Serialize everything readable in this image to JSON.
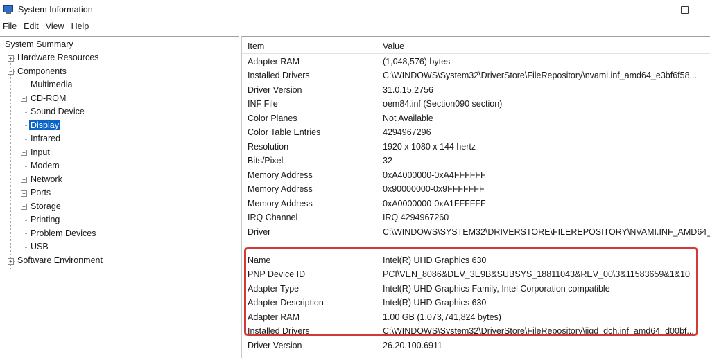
{
  "window": {
    "title": "System Information"
  },
  "menu": [
    "File",
    "Edit",
    "View",
    "Help"
  ],
  "tree": {
    "root": "System Summary",
    "hardware": "Hardware Resources",
    "components": "Components",
    "children": [
      "Multimedia",
      "CD-ROM",
      "Sound Device",
      "Display",
      "Infrared",
      "Input",
      "Modem",
      "Network",
      "Ports",
      "Storage",
      "Printing",
      "Problem Devices",
      "USB"
    ],
    "software": "Software Environment",
    "selected": "Display"
  },
  "table": {
    "headers": {
      "item": "Item",
      "value": "Value"
    },
    "group1": [
      {
        "item": "Adapter RAM",
        "value": "(1,048,576) bytes"
      },
      {
        "item": "Installed Drivers",
        "value": "C:\\WINDOWS\\System32\\DriverStore\\FileRepository\\nvami.inf_amd64_e3bf6f58..."
      },
      {
        "item": "Driver Version",
        "value": "31.0.15.2756"
      },
      {
        "item": "INF File",
        "value": "oem84.inf (Section090 section)"
      },
      {
        "item": "Color Planes",
        "value": "Not Available"
      },
      {
        "item": "Color Table Entries",
        "value": "4294967296"
      },
      {
        "item": "Resolution",
        "value": "1920 x 1080 x 144 hertz"
      },
      {
        "item": "Bits/Pixel",
        "value": "32"
      },
      {
        "item": "Memory Address",
        "value": "0xA4000000-0xA4FFFFFF"
      },
      {
        "item": "Memory Address",
        "value": "0x90000000-0x9FFFFFFF"
      },
      {
        "item": "Memory Address",
        "value": "0xA0000000-0xA1FFFFFF"
      },
      {
        "item": "IRQ Channel",
        "value": "IRQ 4294967260"
      },
      {
        "item": "Driver",
        "value": "C:\\WINDOWS\\SYSTEM32\\DRIVERSTORE\\FILEREPOSITORY\\NVAMI.INF_AMD64_..."
      }
    ],
    "group2": [
      {
        "item": "Name",
        "value": "Intel(R) UHD Graphics 630"
      },
      {
        "item": "PNP Device ID",
        "value": "PCI\\VEN_8086&DEV_3E9B&SUBSYS_18811043&REV_00\\3&11583659&1&10"
      },
      {
        "item": "Adapter Type",
        "value": "Intel(R) UHD Graphics Family, Intel Corporation compatible"
      },
      {
        "item": "Adapter Description",
        "value": "Intel(R) UHD Graphics 630"
      },
      {
        "item": "Adapter RAM",
        "value": "1.00 GB (1,073,741,824 bytes)"
      },
      {
        "item": "Installed Drivers",
        "value": "C:\\WINDOWS\\System32\\DriverStore\\FileRepository\\iigd_dch.inf_amd64_d00bf..."
      },
      {
        "item": "Driver Version",
        "value": "26.20.100.6911"
      }
    ]
  },
  "colors": {
    "selection": "#0a63c9",
    "highlight_border": "#d23a3a"
  }
}
